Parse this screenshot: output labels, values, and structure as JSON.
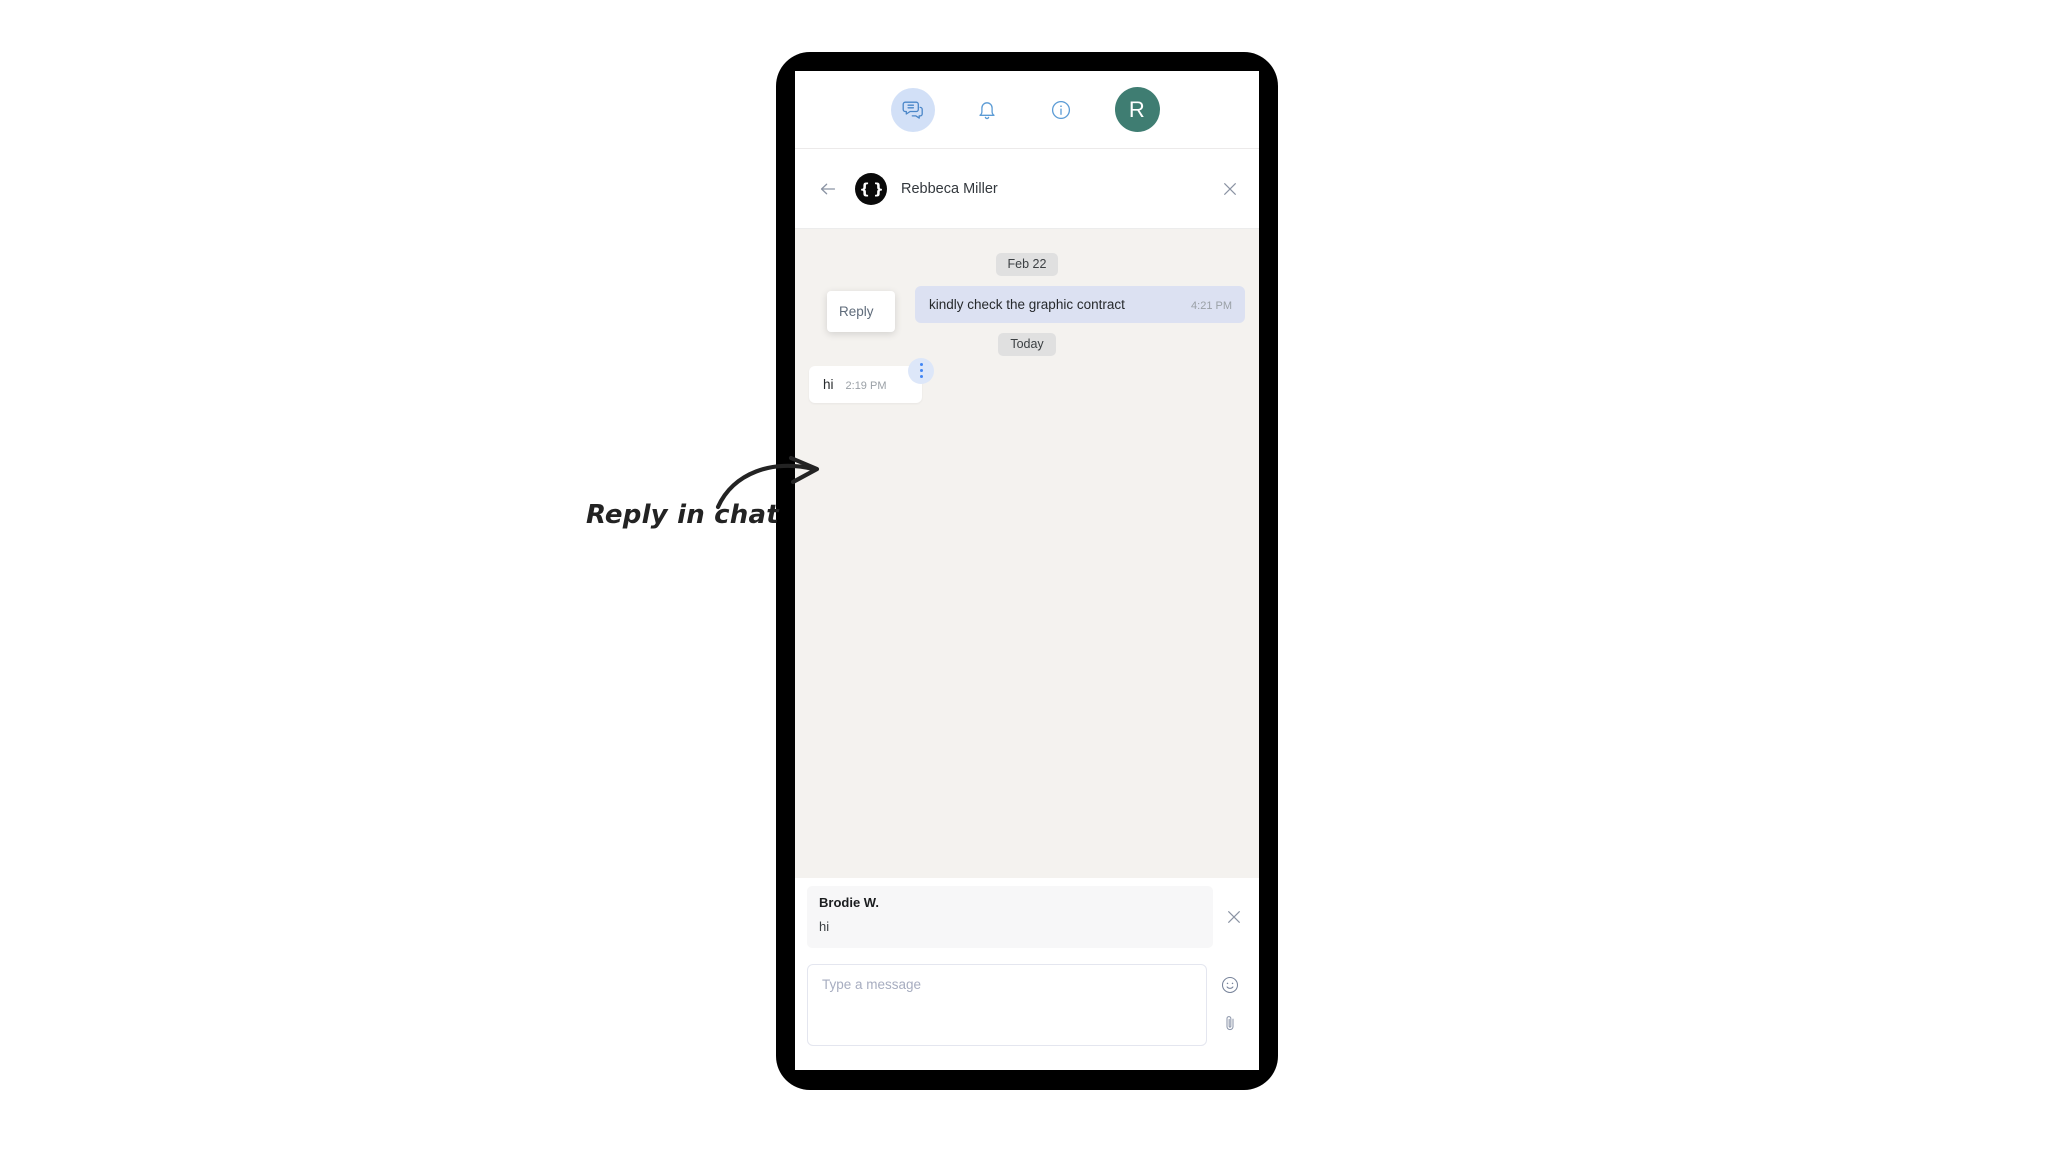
{
  "app": {
    "background_color": "#ffffff",
    "device_frame_color": "#000000"
  },
  "topnav": {
    "items": [
      {
        "name": "chat",
        "icon": "chat-bubbles-icon",
        "active": true,
        "label": "Chat"
      },
      {
        "name": "notifications",
        "icon": "bell-icon",
        "active": false,
        "label": "Notifications"
      },
      {
        "name": "info",
        "icon": "info-circle-icon",
        "active": false,
        "label": "Info"
      }
    ],
    "active_pill_color": "#d2e0f7",
    "icon_color": "#5b9bd5",
    "avatar": {
      "initial": "R",
      "background_color": "#3f7d72",
      "text_color": "#ffffff"
    }
  },
  "chat_header": {
    "back_label": "Back",
    "avatar_glyph": "{ }",
    "avatar_background": "#0a0a0a",
    "peer_name": "Rebbeca Miller",
    "close_label": "Close"
  },
  "conversation": {
    "background_color": "#f4f2ef",
    "items": [
      {
        "kind": "divider",
        "label": "Feb 22"
      },
      {
        "kind": "message",
        "direction": "out",
        "text": "kindly check the graphic contract",
        "time": "4:21 PM",
        "bubble_color": "#dce1f2"
      },
      {
        "kind": "divider",
        "label": "Today"
      },
      {
        "kind": "message",
        "direction": "in",
        "text": "hi",
        "time": "2:19 PM",
        "bubble_color": "#ffffff",
        "menu_open": true
      }
    ],
    "context_menu": {
      "items": [
        {
          "label": "Reply"
        }
      ]
    }
  },
  "reply_preview": {
    "author": "Brodie W.",
    "body": "hi",
    "close_label": "Dismiss reply"
  },
  "composer": {
    "placeholder": "Type a message",
    "value": "",
    "tools": [
      {
        "name": "emoji",
        "icon": "smiley-icon",
        "label": "Emoji"
      },
      {
        "name": "attach",
        "icon": "paperclip-icon",
        "label": "Attach file"
      }
    ]
  },
  "annotation": {
    "text": "Reply in chat",
    "color": "#232323"
  }
}
